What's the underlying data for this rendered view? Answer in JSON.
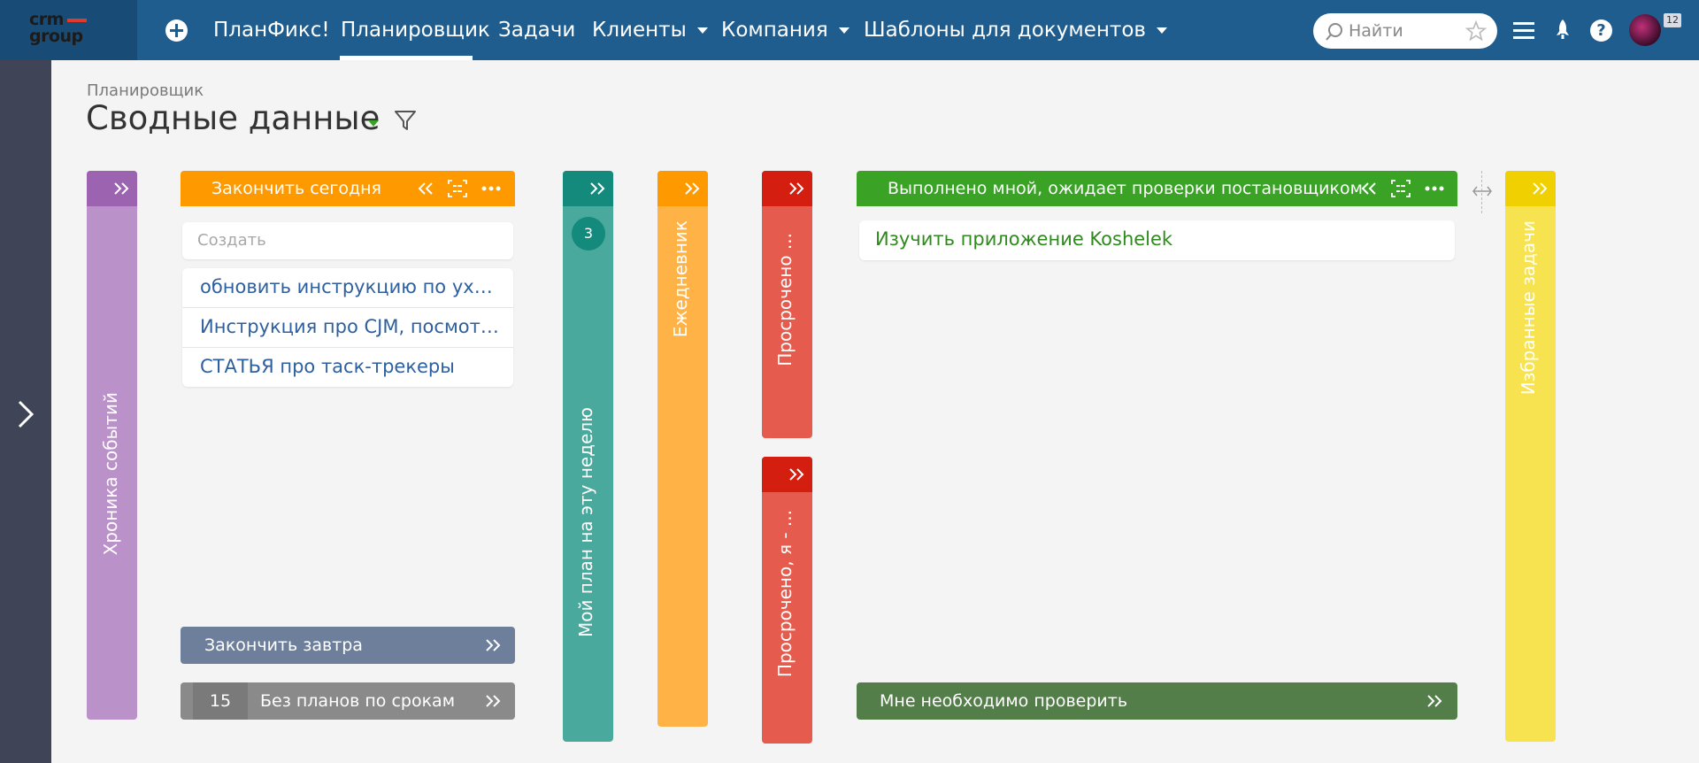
{
  "header": {
    "logo_line1": "crm",
    "logo_line2": "group",
    "nav": [
      {
        "label": "ПланФикс!"
      },
      {
        "label": "Планировщик"
      },
      {
        "label": "Задачи"
      },
      {
        "label": "Клиенты"
      },
      {
        "label": "Компания"
      },
      {
        "label": "Шаблоны для документов"
      }
    ],
    "search_placeholder": "Найти",
    "notification_count": "12"
  },
  "page": {
    "breadcrumb": "Планировщик",
    "title": "Сводные данные"
  },
  "columns": {
    "chronicle": {
      "label": "Хроника событий",
      "color": "#bb91c9",
      "header_color": "#9b63b0"
    },
    "today": {
      "title": "Закончить сегодня",
      "color": "#ff9900",
      "create_placeholder": "Создать",
      "tasks": [
        "обновить инструкцию по уходу из...",
        "Инструкция про CJM, посмотрела ...",
        "СТАТЬЯ про таск-трекеры"
      ],
      "tomorrow_label": "Закончить завтра",
      "tomorrow_color": "#6e7f9c",
      "no_deadline_count": "15",
      "no_deadline_label": "Без планов по срокам",
      "no_deadline_color": "#8a8a8a"
    },
    "week_plan": {
      "label": "Мой план на эту неделю",
      "count": "3",
      "color": "#4aa99d",
      "header_color": "#138a7c"
    },
    "daily": {
      "label": "Ежедневник",
      "color": "#ffb347",
      "header_color": "#ff9900"
    },
    "overdue": {
      "label": "Просрочено ...",
      "color": "#e55b4d",
      "header_color": "#d41f10"
    },
    "overdue_me": {
      "label": "Просрочено, я - ...",
      "color": "#e55b4d",
      "header_color": "#d41f10"
    },
    "done_review": {
      "title": "Выполнено мной, ожидает проверки постановщиком",
      "color": "#3aa326",
      "tasks": [
        "Изучить приложение Koshelek"
      ],
      "check_label": "Мне необходимо проверить",
      "check_color": "#537d49"
    },
    "favorites": {
      "label": "Избранные задачи",
      "color": "#f7e34f",
      "header_color": "#f0d000"
    }
  }
}
